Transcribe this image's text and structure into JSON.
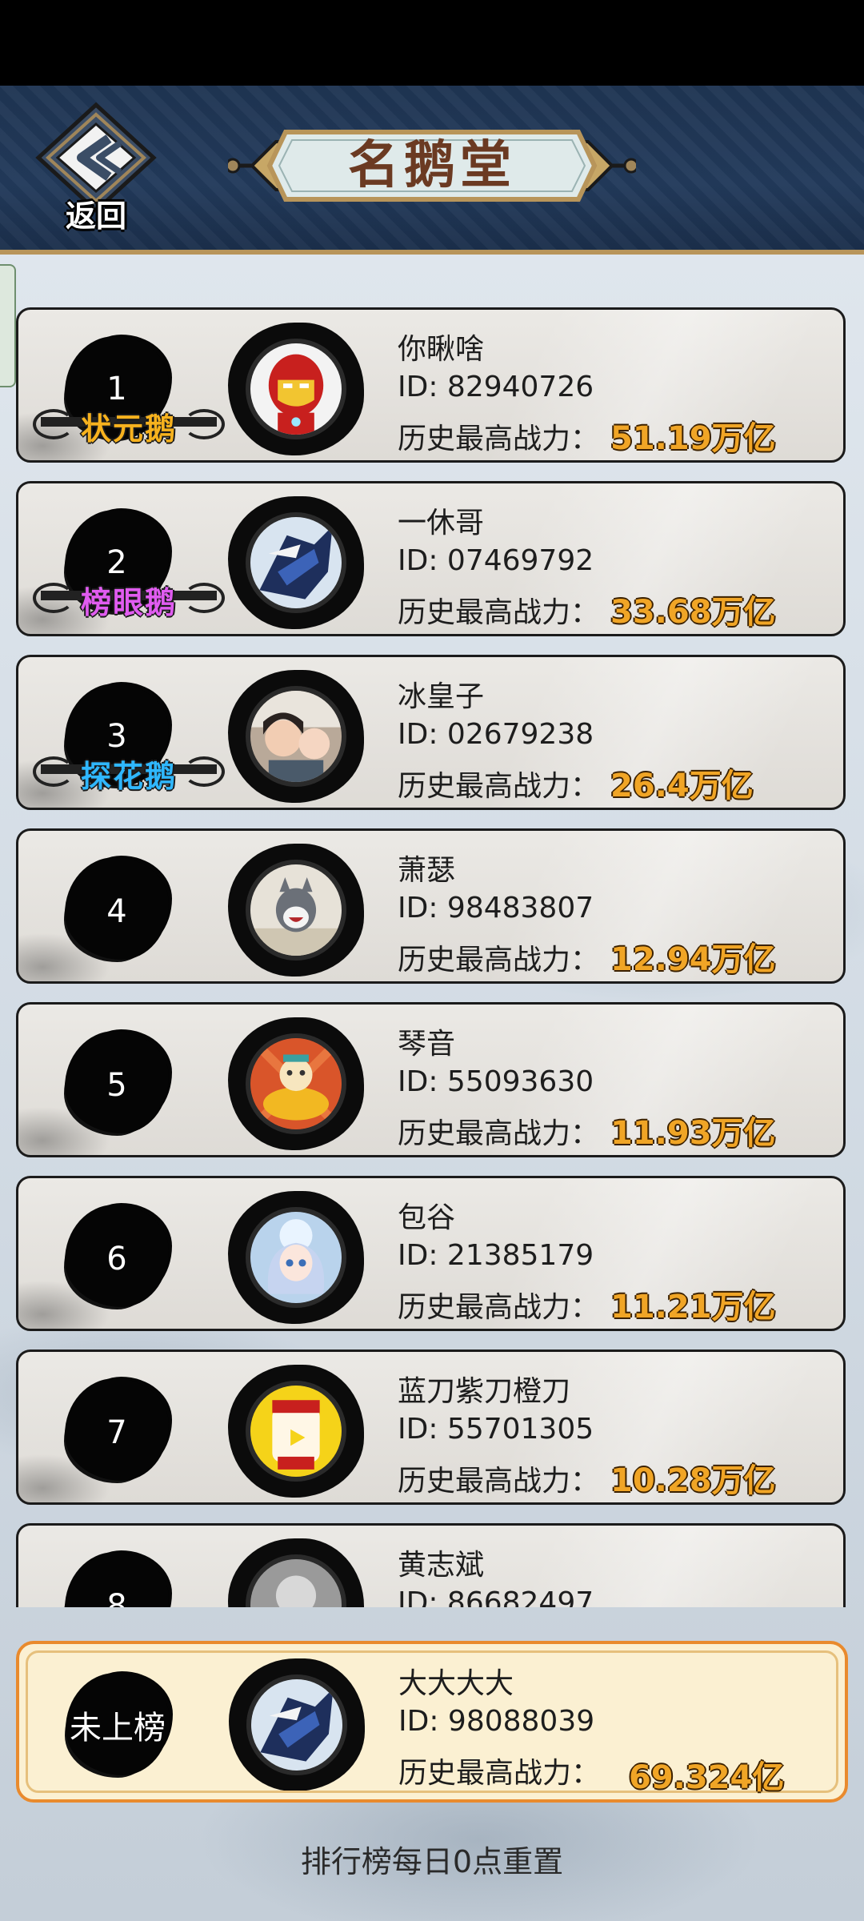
{
  "header": {
    "back_label": "返回",
    "title": "名鹅堂"
  },
  "ranking": [
    {
      "rank": "1",
      "title": "状元鹅",
      "title_color": "#f7b21e",
      "name": "你瞅啥",
      "id": "ID: 82940726",
      "power_label": "历史最高战力：",
      "power": "51.19万亿",
      "avatar": "iron-man-avatar"
    },
    {
      "rank": "2",
      "title": "榜眼鹅",
      "title_color": "#e05cf0",
      "name": "一休哥",
      "id": "ID: 07469792",
      "power_label": "历史最高战力：",
      "power": "33.68万亿",
      "avatar": "ninja-avatar"
    },
    {
      "rank": "3",
      "title": "探花鹅",
      "title_color": "#2fb7ff",
      "name": "冰皇子",
      "id": "ID: 02679238",
      "power_label": "历史最高战力：",
      "power": "26.4万亿",
      "avatar": "photo-avatar"
    },
    {
      "rank": "4",
      "title": "",
      "title_color": "",
      "name": "萧瑟",
      "id": "ID: 98483807",
      "power_label": "历史最高战力：",
      "power": "12.94万亿",
      "avatar": "cartoon-cat-avatar"
    },
    {
      "rank": "5",
      "title": "",
      "title_color": "",
      "name": "琴音",
      "id": "ID: 55093630",
      "power_label": "历史最高战力：",
      "power": "11.93万亿",
      "avatar": "gold-ingot-avatar"
    },
    {
      "rank": "6",
      "title": "",
      "title_color": "",
      "name": "包谷",
      "id": "ID: 21385179",
      "power_label": "历史最高战力：",
      "power": "11.21万亿",
      "avatar": "anime-girl-avatar"
    },
    {
      "rank": "7",
      "title": "",
      "title_color": "",
      "name": "蓝刀紫刀橙刀",
      "id": "ID: 55701305",
      "power_label": "历史最高战力：",
      "power": "10.28万亿",
      "avatar": "yellow-chicken-avatar"
    },
    {
      "rank": "8",
      "title": "",
      "title_color": "",
      "name": "黄志斌",
      "id": "ID: 86682497",
      "power_label": "历史最高战力：",
      "power": "",
      "avatar": "grey-photo-avatar"
    }
  ],
  "my_entry": {
    "rank": "未上榜",
    "name": "大大大大",
    "id": "ID: 98088039",
    "power_label": "历史最高战力：",
    "power": "69.324亿",
    "avatar": "ninja-avatar"
  },
  "footer": {
    "note": "排行榜每日0点重置"
  }
}
